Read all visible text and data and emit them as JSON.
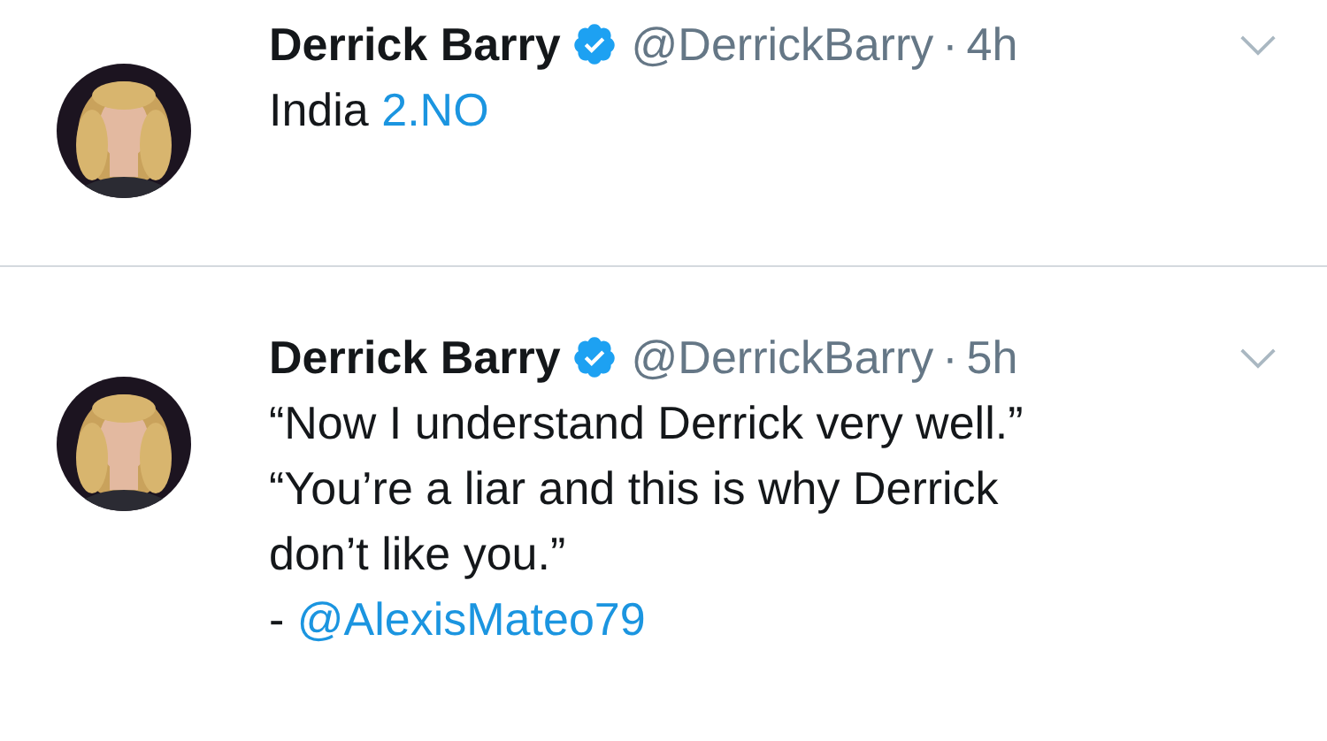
{
  "tweets": [
    {
      "name": "Derrick Barry",
      "verified": true,
      "handle": "@DerrickBarry",
      "separator": "·",
      "time": "4h",
      "lines": [
        [
          {
            "text": "India "
          },
          {
            "link": "2.NO"
          }
        ]
      ]
    },
    {
      "name": "Derrick Barry",
      "verified": true,
      "handle": "@DerrickBarry",
      "separator": "·",
      "time": "5h",
      "lines": [
        [
          {
            "text": "“Now I understand Derrick very well.”"
          }
        ],
        [
          {
            "text": "“You’re a liar and this is why Derrick"
          }
        ],
        [
          {
            "text": "don’t like you.”"
          }
        ],
        [
          {
            "text": "- "
          },
          {
            "link": "@AlexisMateo79"
          }
        ]
      ]
    }
  ]
}
